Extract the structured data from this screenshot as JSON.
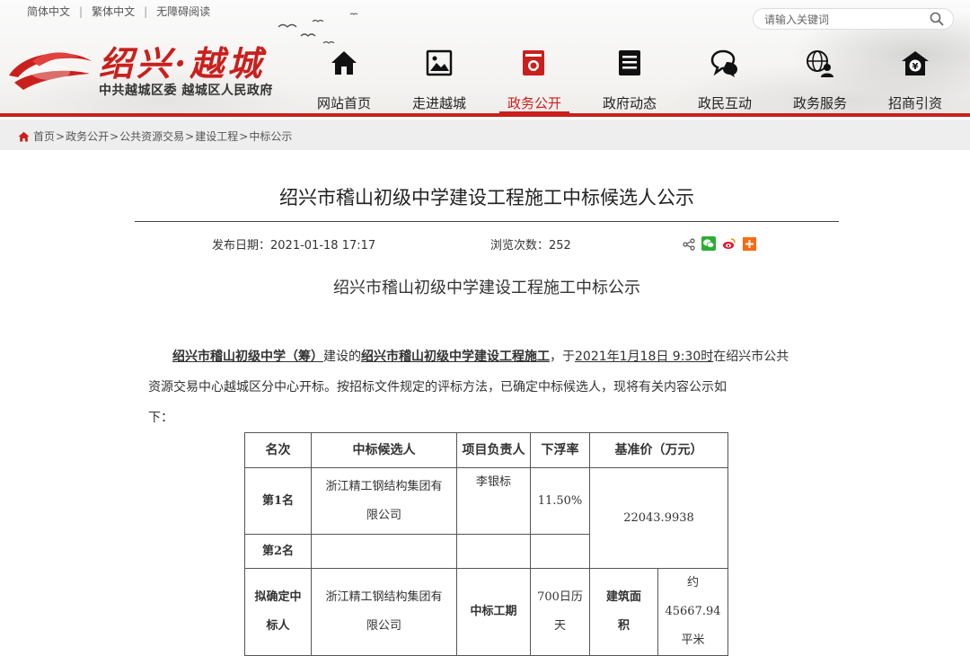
{
  "top_links": [
    "简体中文",
    "繁体中文",
    "无障碍阅读"
  ],
  "search": {
    "placeholder": "请输入关键词"
  },
  "logo": {
    "title": "绍兴·越城",
    "subtitle": "中共越城区委 越城区人民政府"
  },
  "nav": {
    "items": [
      {
        "label": "网站首页",
        "icon": "home-icon"
      },
      {
        "label": "走进越城",
        "icon": "picture-icon"
      },
      {
        "label": "政务公开",
        "icon": "search-document-icon",
        "active": true
      },
      {
        "label": "政府动态",
        "icon": "news-icon"
      },
      {
        "label": "政民互动",
        "icon": "chat-icon"
      },
      {
        "label": "政务服务",
        "icon": "globe-user-icon"
      },
      {
        "label": "招商引资",
        "icon": "house-yen-icon"
      }
    ],
    "accent": "#c9201d"
  },
  "breadcrumb": [
    "首页",
    "政务公开",
    "公共资源交易",
    "建设工程",
    "中标公示"
  ],
  "article": {
    "title": "绍兴市稽山初级中学建设工程施工中标候选人公示",
    "publish_label": "发布日期：",
    "publish_date": "2021-01-18 17:17",
    "views_label": "浏览次数：",
    "views": "252",
    "subtitle": "绍兴市稽山初级中学建设工程施工中标公示",
    "para": {
      "owner": "绍兴市稽山初级中学（筹）",
      "t1": "建设的",
      "project": "绍兴市稽山初级中学建设工程施工",
      "t2": "，于",
      "time": "2021年1月18日 9:30时",
      "t3": "在绍兴市公共",
      "line2": "资源交易中心越城区分中心开标。按招标文件规定的评标方法，已确定中标候选人，现将有关内容公示如",
      "line3": "下："
    }
  },
  "table": {
    "headers": [
      "名次",
      "中标候选人",
      "项目负责人",
      "下浮率",
      "基准价（万元）"
    ],
    "rank1": "第1名",
    "rank1_company_a": "浙江精工钢结构集团有",
    "rank1_company_b": "限公司",
    "rank1_manager": "李银标",
    "rank1_rate": "11.50%",
    "base_price": "22043.9938",
    "rank2": "第2名",
    "proposed_a": "拟确定中",
    "proposed_b": "标人",
    "proposed_company_a": "浙江精工钢结构集团有",
    "proposed_company_b": "限公司",
    "period_label": "中标工期",
    "period_a": "700日历",
    "period_b": "天",
    "area_label_a": "建筑面",
    "area_label_b": "积",
    "area_a": "约45667.94",
    "area_b": "平米"
  }
}
